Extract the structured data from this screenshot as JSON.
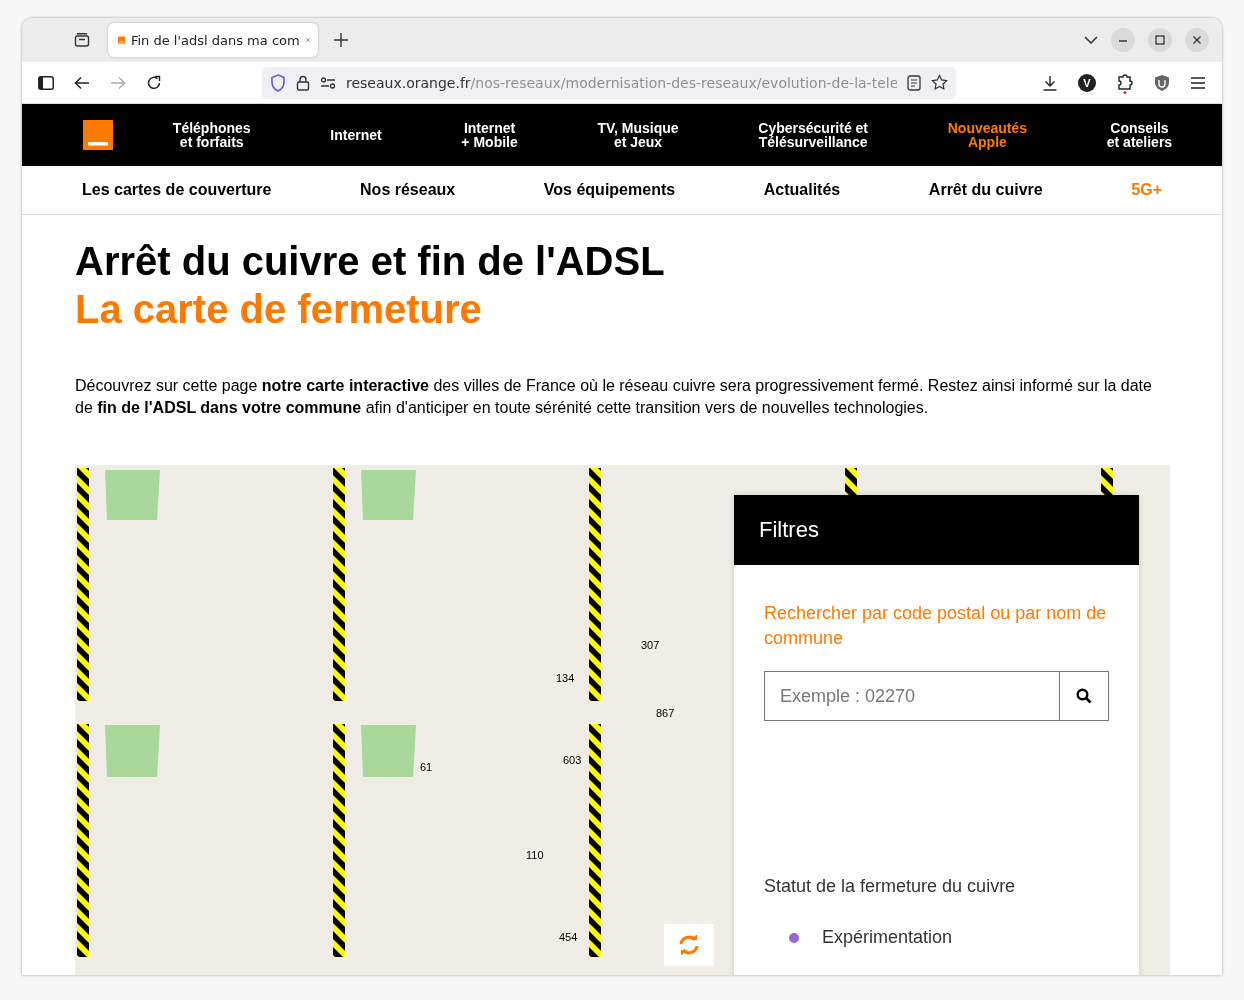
{
  "browser": {
    "tab_title": "Fin de l'adsl dans ma com",
    "url_host": "reseaux.orange.fr",
    "url_path": "/nos-reseaux/modernisation-des-reseaux/evolution-de-la-tele",
    "forward_disabled": true,
    "avatar_letter": "V"
  },
  "main_nav": {
    "items": [
      {
        "lines": [
          "Téléphones",
          "et forfaits"
        ],
        "highlighted": false
      },
      {
        "lines": [
          "Internet"
        ],
        "highlighted": false
      },
      {
        "lines": [
          "Internet",
          "+ Mobile"
        ],
        "highlighted": false
      },
      {
        "lines": [
          "TV, Musique",
          "et Jeux"
        ],
        "highlighted": false
      },
      {
        "lines": [
          "Cybersécurité et",
          "Télésurveillance"
        ],
        "highlighted": false
      },
      {
        "lines": [
          "Nouveautés",
          "Apple"
        ],
        "highlighted": true
      },
      {
        "lines": [
          "Conseils",
          "et ateliers"
        ],
        "highlighted": false
      }
    ]
  },
  "sub_nav": {
    "items": [
      {
        "label": "Les cartes de couverture",
        "highlighted": false
      },
      {
        "label": "Nos réseaux",
        "highlighted": false
      },
      {
        "label": "Vos équipements",
        "highlighted": false
      },
      {
        "label": "Actualités",
        "highlighted": false
      },
      {
        "label": "Arrêt du cuivre",
        "highlighted": false
      },
      {
        "label": "5G+",
        "highlighted": true
      }
    ]
  },
  "title": "Arrêt du cuivre et fin de l'ADSL",
  "subtitle": "La carte de fermeture",
  "intro": "Découvrez sur cette page **notre carte interactive** des villes de France où le réseau cuivre sera progressivement fermé. Restez ainsi informé sur la date de **fin de l'ADSL dans votre commune** afin d'anticiper en toute sérénité cette transition vers de nouvelles technologies.",
  "map": {
    "kind": "picture",
    "clusters": [
      {
        "label": "134"
      },
      {
        "label": "307"
      },
      {
        "label": "867"
      },
      {
        "label": "603"
      },
      {
        "label": "61"
      },
      {
        "label": "110"
      },
      {
        "label": "454"
      }
    ],
    "filters": {
      "title": "Filtres",
      "search_label": "Rechercher par code postal ou par nom de commune",
      "placeholder": "Exemple : 02270",
      "status_title": "Statut de la fermeture du cuivre",
      "legend": [
        {
          "label": "Expérimentation",
          "color": "#9b64d0"
        }
      ]
    }
  }
}
